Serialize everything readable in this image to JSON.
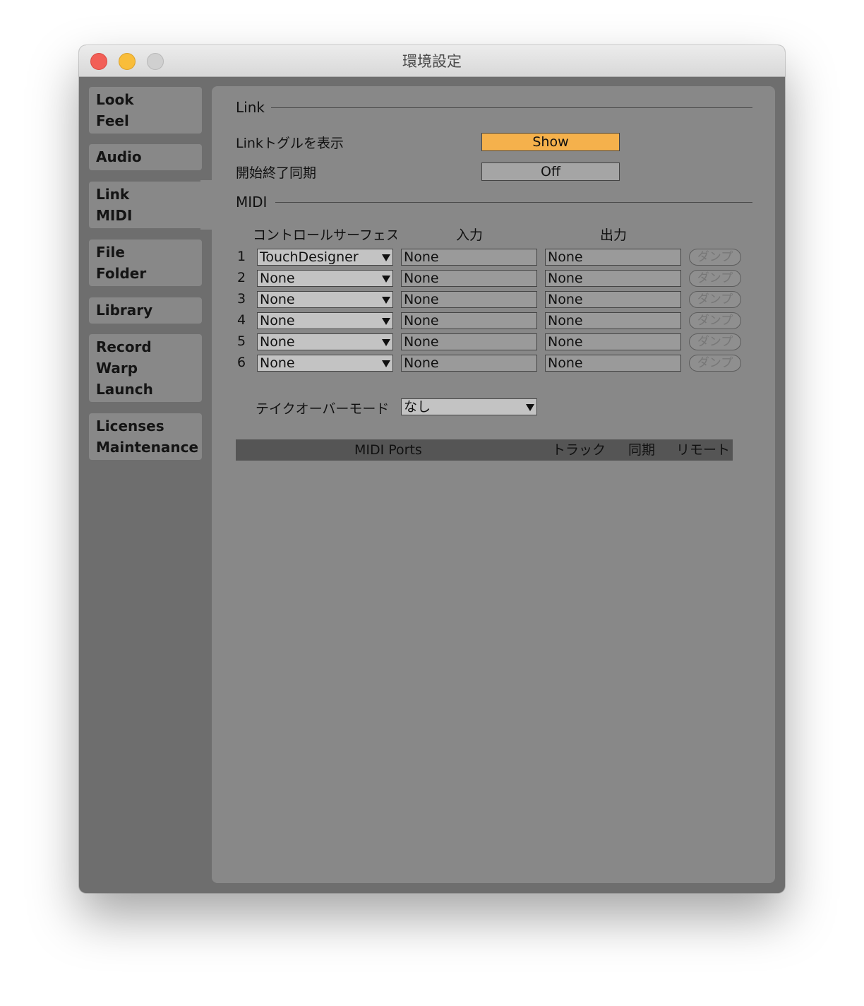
{
  "window": {
    "title": "環境設定"
  },
  "sidebar": {
    "tabs": [
      {
        "lines": [
          "Look",
          "Feel"
        ]
      },
      {
        "lines": [
          "Audio"
        ]
      },
      {
        "lines": [
          "Link",
          "MIDI"
        ]
      },
      {
        "lines": [
          "File",
          "Folder"
        ]
      },
      {
        "lines": [
          "Library"
        ]
      },
      {
        "lines": [
          "Record",
          "Warp",
          "Launch"
        ]
      },
      {
        "lines": [
          "Licenses",
          "Maintenance"
        ]
      }
    ],
    "active": "Link MIDI"
  },
  "link": {
    "title": "Link",
    "show_toggle_label": "Linkトグルを表示",
    "show_toggle_value": "Show",
    "start_stop_label": "開始終了同期",
    "start_stop_value": "Off"
  },
  "midi": {
    "title": "MIDI",
    "headers": {
      "surface": "コントロールサーフェス",
      "input": "入力",
      "output": "出力"
    },
    "rows": [
      {
        "num": "1",
        "surface": "TouchDesigner",
        "input": "None",
        "output": "None",
        "dump": "ダンプ"
      },
      {
        "num": "2",
        "surface": "None",
        "input": "None",
        "output": "None",
        "dump": "ダンプ"
      },
      {
        "num": "3",
        "surface": "None",
        "input": "None",
        "output": "None",
        "dump": "ダンプ"
      },
      {
        "num": "4",
        "surface": "None",
        "input": "None",
        "output": "None",
        "dump": "ダンプ"
      },
      {
        "num": "5",
        "surface": "None",
        "input": "None",
        "output": "None",
        "dump": "ダンプ"
      },
      {
        "num": "6",
        "surface": "None",
        "input": "None",
        "output": "None",
        "dump": "ダンプ"
      }
    ],
    "takeover_label": "テイクオーバーモード",
    "takeover_value": "なし",
    "ports_table": {
      "title": "MIDI Ports",
      "track": "トラック",
      "sync": "同期",
      "remote": "リモート"
    }
  },
  "colors": {
    "accent_toggle": "#f5b14c",
    "panel": "#888888",
    "sidebar_bg": "#6e6e6e"
  }
}
